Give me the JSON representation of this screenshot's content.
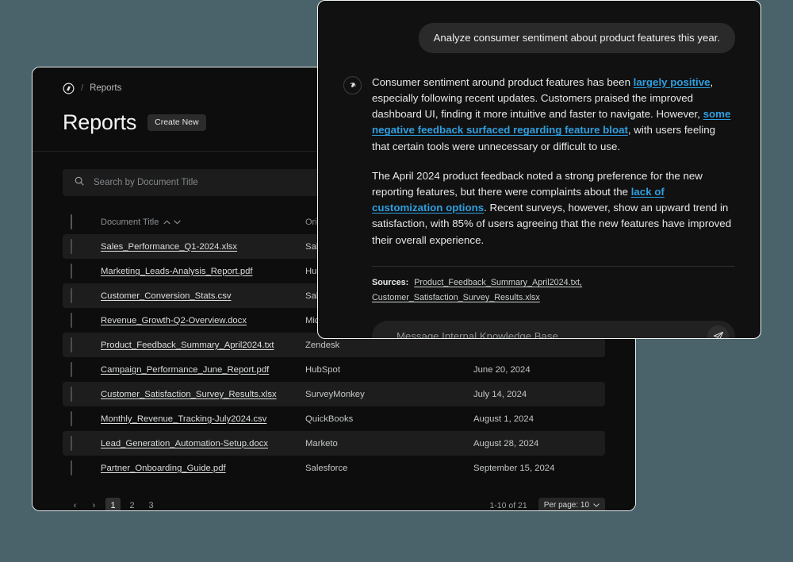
{
  "theme": {
    "desktop_bg": "#4a636b",
    "window_bg": "#0d0d0d",
    "panel_bg": "#111111",
    "link_accent": "#2f9fe0",
    "row_alt_bg": "#1d1d1d"
  },
  "reports_window": {
    "breadcrumb": {
      "logo_icon": "brand-hexagon-icon",
      "separator": "/",
      "current": "Reports"
    },
    "page_title": "Reports",
    "create_new_label": "Create New",
    "search": {
      "icon": "search-icon",
      "placeholder": "Search by Document Title",
      "value": ""
    },
    "table": {
      "columns": [
        {
          "key": "title",
          "label": "Document Title",
          "sortable": true
        },
        {
          "key": "origin",
          "label": "Origin",
          "sortable": true
        },
        {
          "key": "date",
          "label": "",
          "sortable": false
        }
      ],
      "rows": [
        {
          "title": "Sales_Performance_Q1-2024.xlsx",
          "origin": "Salesforce",
          "date": ""
        },
        {
          "title": "Marketing_Leads-Analysis_Report.pdf",
          "origin": "HubSpot",
          "date": ""
        },
        {
          "title": "Customer_Conversion_Stats.csv",
          "origin": "Salesforce",
          "date": ""
        },
        {
          "title": "Revenue_Growth-Q2-Overview.docx",
          "origin": "Microsoft Dynamics",
          "date": ""
        },
        {
          "title": "Product_Feedback_Summary_April2024.txt",
          "origin": "Zendesk",
          "date": ""
        },
        {
          "title": "Campaign_Performance_June_Report.pdf",
          "origin": "HubSpot",
          "date": "June 20, 2024"
        },
        {
          "title": "Customer_Satisfaction_Survey_Results.xlsx",
          "origin": "SurveyMonkey",
          "date": "July 14, 2024"
        },
        {
          "title": "Monthly_Revenue_Tracking-July2024.csv",
          "origin": "QuickBooks",
          "date": "August 1, 2024"
        },
        {
          "title": "Lead_Generation_Automation-Setup.docx",
          "origin": "Marketo",
          "date": "August 28, 2024"
        },
        {
          "title": "Partner_Onboarding_Guide.pdf",
          "origin": "Salesforce",
          "date": "September 15, 2024"
        }
      ]
    },
    "pagination": {
      "prev_label": "‹",
      "next_label": "›",
      "pages": [
        "1",
        "2",
        "3"
      ],
      "active_page": "1",
      "range_text": "1-10 of 21",
      "per_page_label": "Per page: 10"
    }
  },
  "chat_panel": {
    "user_message": "Analyze consumer sentiment about product features this year.",
    "assistant_avatar_icon": "brand-hexagon-icon",
    "assistant_paragraph_1": {
      "part_1": "Consumer sentiment around product features has been ",
      "link_1": "largely positive",
      "part_2": ", especially following recent updates. Customers praised the improved dashboard UI, finding it more intuitive and faster to navigate. However, ",
      "link_2": "some negative feedback surfaced regarding feature bloat",
      "part_3": ", with users feeling that certain tools were unnecessary or difficult to use."
    },
    "assistant_paragraph_2": {
      "part_1": "The April 2024 product feedback noted a strong preference for the new reporting features, but there were complaints about the ",
      "link_1": "lack of customization options",
      "part_2": ". Recent surveys, however, show an upward trend in satisfaction, with 85% of users agreeing that the new features have improved their overall experience."
    },
    "sources_label": "Sources:",
    "sources": [
      "Product_Feedback_Summary_April2024.txt,",
      "Customer_Satisfaction_Survey_Results.xlsx"
    ],
    "input": {
      "placeholder": "Message Internal Knowledge Base",
      "value": ""
    },
    "send_icon": "send-paper-plane-icon"
  }
}
